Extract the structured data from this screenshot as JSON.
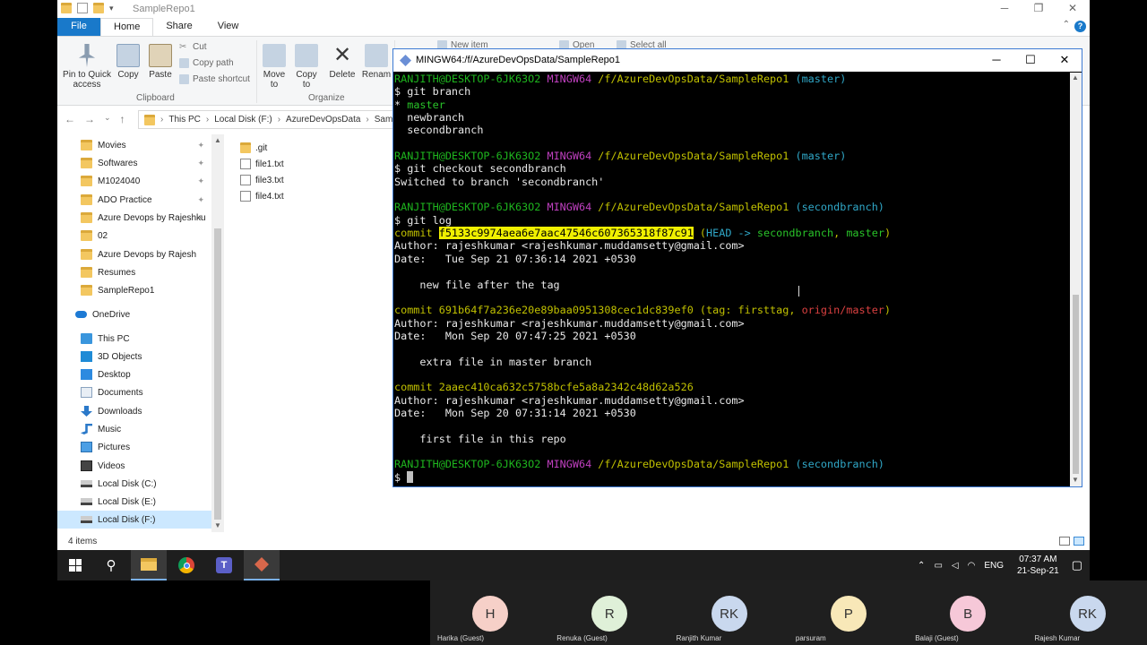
{
  "explorer": {
    "title": "SampleRepo1",
    "tabs": [
      "File",
      "Home",
      "Share",
      "View"
    ],
    "ribbon": {
      "pin_label": "Pin to Quick access",
      "copy_label": "Copy",
      "paste_label": "Paste",
      "cut_label": "Cut",
      "copy_path_label": "Copy path",
      "paste_shortcut_label": "Paste shortcut",
      "clipboard_group": "Clipboard",
      "move_to_label": "Move to",
      "copy_to_label": "Copy to",
      "delete_label": "Delete",
      "rename_label": "Renam",
      "organize_group": "Organize",
      "new_item_label": "New item",
      "open_label": "Open",
      "select_all_label": "Select all"
    },
    "address": {
      "crumbs": [
        "This PC",
        "Local Disk (F:)",
        "AzureDevOpsData",
        "Sam"
      ]
    },
    "nav": [
      {
        "label": "Movies",
        "icon": "folder-icon",
        "pinned": true
      },
      {
        "label": "Softwares",
        "icon": "folder-icon",
        "pinned": true
      },
      {
        "label": "M1024040",
        "icon": "folder-icon",
        "pinned": true
      },
      {
        "label": "ADO Practice",
        "icon": "folder-icon",
        "pinned": true
      },
      {
        "label": "Azure Devops by Rajeshku",
        "icon": "folder-icon",
        "pinned": true
      },
      {
        "label": "02",
        "icon": "folder-icon",
        "pinned": false
      },
      {
        "label": "Azure Devops by Rajesh",
        "icon": "folder-icon",
        "pinned": false
      },
      {
        "label": "Resumes",
        "icon": "folder-icon",
        "pinned": false
      },
      {
        "label": "SampleRepo1",
        "icon": "folder-icon",
        "pinned": false
      },
      {
        "label": "OneDrive",
        "icon": "cloud-icon",
        "pinned": false
      },
      {
        "label": "This PC",
        "icon": "pc-icon",
        "pinned": false
      },
      {
        "label": "3D Objects",
        "icon": "3d-objects-icon",
        "pinned": false
      },
      {
        "label": "Desktop",
        "icon": "desktop-icon",
        "pinned": false
      },
      {
        "label": "Documents",
        "icon": "documents-icon",
        "pinned": false
      },
      {
        "label": "Downloads",
        "icon": "downloads-icon",
        "pinned": false
      },
      {
        "label": "Music",
        "icon": "music-icon",
        "pinned": false
      },
      {
        "label": "Pictures",
        "icon": "pictures-icon",
        "pinned": false
      },
      {
        "label": "Videos",
        "icon": "videos-icon",
        "pinned": false
      },
      {
        "label": "Local Disk (C:)",
        "icon": "drive-icon",
        "pinned": false
      },
      {
        "label": "Local Disk (E:)",
        "icon": "drive-icon",
        "pinned": false
      },
      {
        "label": "Local Disk (F:)",
        "icon": "drive-icon",
        "pinned": false,
        "selected": true
      }
    ],
    "files": [
      {
        "name": ".git",
        "type": "folder"
      },
      {
        "name": "file1.txt",
        "type": "file"
      },
      {
        "name": "file3.txt",
        "type": "file"
      },
      {
        "name": "file4.txt",
        "type": "file"
      }
    ],
    "status_count": "4 items"
  },
  "terminal": {
    "title": "MINGW64:/f/AzureDevOpsData/SampleRepo1",
    "lines": [
      [
        {
          "t": "RANJITH@DESKTOP-6JK63O2 ",
          "c": "green"
        },
        {
          "t": "MINGW64 ",
          "c": "magenta"
        },
        {
          "t": "/f/AzureDevOpsData/SampleRepo1",
          "c": "yellow"
        },
        {
          "t": " (master)",
          "c": "cyan"
        }
      ],
      [
        {
          "t": "$ git branch",
          "c": "white"
        }
      ],
      [
        {
          "t": "* ",
          "c": "white"
        },
        {
          "t": "master",
          "c": "green2"
        }
      ],
      [
        {
          "t": "  newbranch",
          "c": "white"
        }
      ],
      [
        {
          "t": "  secondbranch",
          "c": "white"
        }
      ],
      [
        {
          "t": "",
          "c": "white"
        }
      ],
      [
        {
          "t": "RANJITH@DESKTOP-6JK63O2 ",
          "c": "green"
        },
        {
          "t": "MINGW64 ",
          "c": "magenta"
        },
        {
          "t": "/f/AzureDevOpsData/SampleRepo1",
          "c": "yellow"
        },
        {
          "t": " (master)",
          "c": "cyan"
        }
      ],
      [
        {
          "t": "$ git checkout secondbranch",
          "c": "white"
        }
      ],
      [
        {
          "t": "Switched to branch 'secondbranch'",
          "c": "white"
        }
      ],
      [
        {
          "t": "",
          "c": "white"
        }
      ],
      [
        {
          "t": "RANJITH@DESKTOP-6JK63O2 ",
          "c": "green"
        },
        {
          "t": "MINGW64 ",
          "c": "magenta"
        },
        {
          "t": "/f/AzureDevOpsData/SampleRepo1",
          "c": "yellow"
        },
        {
          "t": " (secondbranch)",
          "c": "cyan"
        }
      ],
      [
        {
          "t": "$ git log",
          "c": "white"
        }
      ],
      [
        {
          "t": "commit ",
          "c": "yellow"
        },
        {
          "t": "f5133c9974aea6e7aac47546c607365318f87c91",
          "c": "sel"
        },
        {
          "t": " (",
          "c": "yellow"
        },
        {
          "t": "HEAD -> ",
          "c": "cyan"
        },
        {
          "t": "secondbranch",
          "c": "green2"
        },
        {
          "t": ", ",
          "c": "yellow"
        },
        {
          "t": "master",
          "c": "green2"
        },
        {
          "t": ")",
          "c": "yellow"
        }
      ],
      [
        {
          "t": "Author: rajeshkumar <rajeshkumar.muddamsetty@gmail.com>",
          "c": "white"
        }
      ],
      [
        {
          "t": "Date:   Tue Sep 21 07:36:14 2021 +0530",
          "c": "white"
        }
      ],
      [
        {
          "t": "",
          "c": "white"
        }
      ],
      [
        {
          "t": "    new file after the tag",
          "c": "white"
        }
      ],
      [
        {
          "t": "",
          "c": "white"
        }
      ],
      [
        {
          "t": "commit 691b64f7a236e20e89baa0951308cec1dc839ef0 (",
          "c": "yellow"
        },
        {
          "t": "tag: firsttag",
          "c": "yellow"
        },
        {
          "t": ", ",
          "c": "yellow"
        },
        {
          "t": "origin/master",
          "c": "red"
        },
        {
          "t": ")",
          "c": "yellow"
        }
      ],
      [
        {
          "t": "Author: rajeshkumar <rajeshkumar.muddamsetty@gmail.com>",
          "c": "white"
        }
      ],
      [
        {
          "t": "Date:   Mon Sep 20 07:47:25 2021 +0530",
          "c": "white"
        }
      ],
      [
        {
          "t": "",
          "c": "white"
        }
      ],
      [
        {
          "t": "    extra file in master branch",
          "c": "white"
        }
      ],
      [
        {
          "t": "",
          "c": "white"
        }
      ],
      [
        {
          "t": "commit 2aaec410ca632c5758bcfe5a8a2342c48d62a526",
          "c": "yellow"
        }
      ],
      [
        {
          "t": "Author: rajeshkumar <rajeshkumar.muddamsetty@gmail.com>",
          "c": "white"
        }
      ],
      [
        {
          "t": "Date:   Mon Sep 20 07:31:14 2021 +0530",
          "c": "white"
        }
      ],
      [
        {
          "t": "",
          "c": "white"
        }
      ],
      [
        {
          "t": "    first file in this repo",
          "c": "white"
        }
      ],
      [
        {
          "t": "",
          "c": "white"
        }
      ],
      [
        {
          "t": "RANJITH@DESKTOP-6JK63O2 ",
          "c": "green"
        },
        {
          "t": "MINGW64 ",
          "c": "magenta"
        },
        {
          "t": "/f/AzureDevOpsData/SampleRepo1",
          "c": "yellow"
        },
        {
          "t": " (secondbranch)",
          "c": "cyan"
        }
      ],
      [
        {
          "t": "$ ",
          "c": "white"
        }
      ]
    ]
  },
  "taskbar": {
    "lang": "ENG",
    "time": "07:37 AM",
    "date": "21-Sep-21"
  },
  "participants": [
    {
      "initials": "H",
      "name": "Harika (Guest)",
      "color": "#f6d0c8"
    },
    {
      "initials": "R",
      "name": "Renuka (Guest)",
      "color": "#dff0d8"
    },
    {
      "initials": "RK",
      "name": "Ranjith Kumar",
      "color": "#c9d8ee"
    },
    {
      "initials": "P",
      "name": "parsuram",
      "color": "#f8e8b8"
    },
    {
      "initials": "B",
      "name": "Balaji (Guest)",
      "color": "#f6c8d8"
    },
    {
      "initials": "RK",
      "name": "Rajesh Kumar",
      "color": "#c9d8ee"
    }
  ],
  "colors": {
    "accent": "#1979ca",
    "terminal_bg": "#000000",
    "selection": "#f0f000"
  }
}
